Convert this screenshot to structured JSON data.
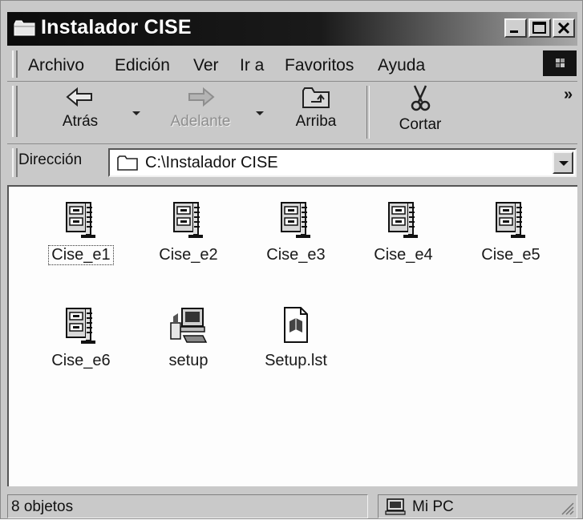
{
  "window": {
    "title": "Instalador CISE"
  },
  "menu": {
    "items": [
      {
        "label": "Archivo"
      },
      {
        "label": "Edición"
      },
      {
        "label": "Ver"
      },
      {
        "label": "Ir a"
      },
      {
        "label": "Favoritos"
      },
      {
        "label": "Ayuda"
      }
    ]
  },
  "toolbar": {
    "back": "Atrás",
    "forward": "Adelante",
    "up": "Arriba",
    "cut": "Cortar",
    "more": "»"
  },
  "address": {
    "label": "Dirección",
    "value": "C:\\Instalador CISE"
  },
  "files": [
    {
      "name": "Cise_e1",
      "icon": "archive-icon",
      "selected": true
    },
    {
      "name": "Cise_e2",
      "icon": "archive-icon"
    },
    {
      "name": "Cise_e3",
      "icon": "archive-icon"
    },
    {
      "name": "Cise_e4",
      "icon": "archive-icon"
    },
    {
      "name": "Cise_e5",
      "icon": "archive-icon"
    },
    {
      "name": "Cise_e6",
      "icon": "archive-icon"
    },
    {
      "name": "setup",
      "icon": "setup-computer-icon"
    },
    {
      "name": "Setup.lst",
      "icon": "document-icon"
    }
  ],
  "status": {
    "count": "8 objetos",
    "location": "Mi PC"
  }
}
